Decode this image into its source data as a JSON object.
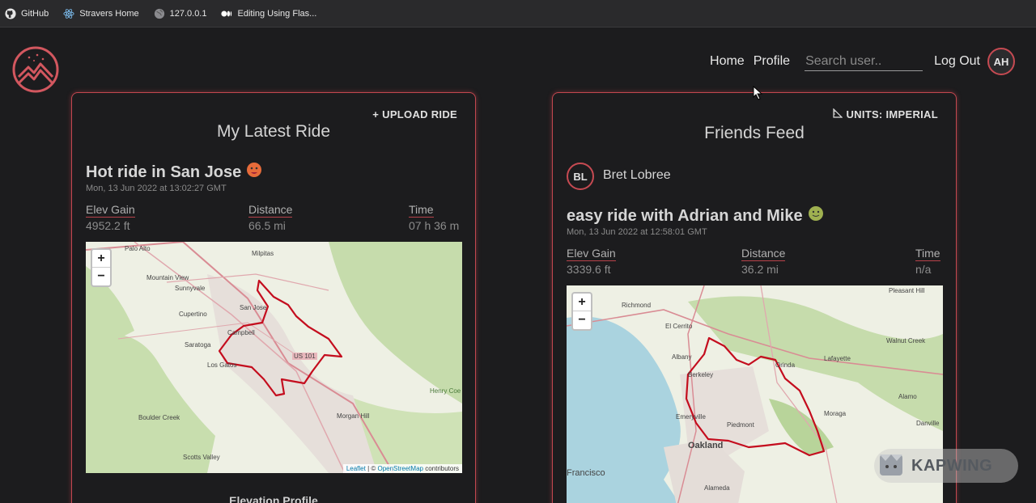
{
  "bookmarks": [
    {
      "label": "GitHub",
      "icon": "github-icon"
    },
    {
      "label": "Stravers Home",
      "icon": "react-icon"
    },
    {
      "label": "127.0.0.1",
      "icon": "globe-icon"
    },
    {
      "label": "Editing Using Flas...",
      "icon": "medium-icon"
    }
  ],
  "nav": {
    "home": "Home",
    "profile": "Profile",
    "search_placeholder": "Search user..",
    "logout": "Log Out",
    "avatar_initials": "AH"
  },
  "latest": {
    "upload_label": "UPLOAD RIDE",
    "title": "My Latest Ride",
    "ride_title": "Hot ride in San Jose",
    "ride_date": "Mon, 13 Jun 2022 at 13:02:27 GMT",
    "stats": [
      {
        "label": "Elev Gain",
        "value": "4952.2 ft"
      },
      {
        "label": "Distance",
        "value": "66.5 mi"
      },
      {
        "label": "Time",
        "value": "07 h 36 m"
      }
    ],
    "map_labels": [
      "Palo Alto",
      "Milpitas",
      "Mountain View",
      "Sunnyvale",
      "Cupertino",
      "San Jose",
      "Campbell",
      "Saratoga",
      "Los Gatos",
      "US 101",
      "Boulder Creek",
      "Morgan Hill",
      "Scotts Valley",
      "Henry Coe State Park"
    ],
    "attrib_leaflet": "Leaflet",
    "attrib_osm": "OpenStreetMap",
    "attrib_rest": "contributors",
    "elevation_title": "Elevation Profile"
  },
  "feed": {
    "units_label": "UNITS: IMPERIAL",
    "title": "Friends Feed",
    "friend_initials": "BL",
    "friend_name": "Bret Lobree",
    "ride_title": "easy ride with Adrian and Mike",
    "ride_date": "Mon, 13 Jun 2022 at 12:58:01 GMT",
    "stats": [
      {
        "label": "Elev Gain",
        "value": "3339.6 ft"
      },
      {
        "label": "Distance",
        "value": "36.2 mi"
      },
      {
        "label": "Time",
        "value": "n/a"
      }
    ],
    "map_labels": [
      "Richmond",
      "El Cerrito",
      "Albany",
      "Berkeley",
      "Orinda",
      "Lafayette",
      "Walnut Creek",
      "Emeryville",
      "Piedmont",
      "Moraga",
      "Oakland",
      "Alamo",
      "Francisco",
      "Alameda",
      "Pleasant Hill",
      "Danville"
    ]
  },
  "watermark": "KAPWING",
  "colors": {
    "accent": "#c2474f",
    "background": "#1c1c1e",
    "route": "#c40d1e"
  }
}
